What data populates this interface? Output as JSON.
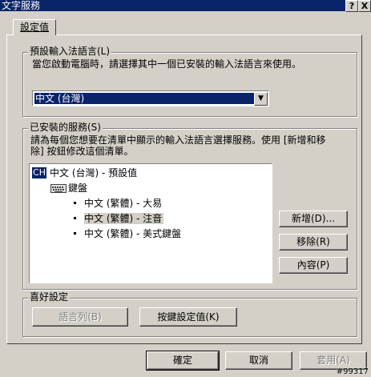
{
  "window": {
    "title": "文字服務",
    "help_btn": "?",
    "close_btn": "X"
  },
  "tab": {
    "label": "設定值"
  },
  "default_language": {
    "group_label": "預設輸入法語言(L)",
    "description": "當您啟動電腦時，請選擇其中一個已安裝的輸入法語言來使用。",
    "selected": "中文 (台灣)",
    "arrow": "▼"
  },
  "installed": {
    "group_label": "已安裝的服務(S)",
    "description_line1": "請為每個您想要在清單中顯示的輸入法語言選擇服務。使用 [新增和移",
    "description_line2": "除] 按鈕修改這個清單。",
    "lang_badge": "CH",
    "lang_label": "中文 (台灣) - 預設值",
    "keyboard_label": "鍵盤",
    "services": [
      "中文 (繁體) - 大易",
      "中文 (繁體) - 注音",
      "中文 (繁體) - 美式鍵盤"
    ],
    "add_button": "新增(D)...",
    "remove_button": "移除(R)",
    "properties_button": "內容(P)"
  },
  "preferences": {
    "group_label": "喜好設定",
    "language_bar_button": "語言列(B)",
    "key_settings_button": "按鍵設定值(K)"
  },
  "footer": {
    "ok_button": "確定",
    "cancel_button": "取消",
    "apply_button": "套用(A)"
  },
  "watermark": "#99317"
}
